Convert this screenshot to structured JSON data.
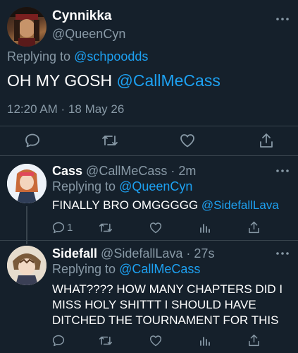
{
  "main_tweet": {
    "display_name": "Cynnikka",
    "handle": "@QueenCyn",
    "replying_prefix": "Replying to",
    "replying_handle": "@schpoodds",
    "text_main": "OH MY GOSH",
    "text_mention": "@CallMeCass",
    "timestamp": "12:20 AM · 18 May 26",
    "actions": [
      "comment-icon",
      "retweet-icon",
      "like-icon",
      "share-icon"
    ]
  },
  "replies": [
    {
      "display_name": "Cass",
      "handle": "@CallMeCass",
      "sep": "·",
      "time": "2m",
      "replying_prefix": "Replying to",
      "replying_handle": "@QueenCyn",
      "text_main": "FINALLY BRO OMGGGGG",
      "text_mention": "@SidefallLava",
      "reply_count": "1",
      "actions": [
        "comment-icon",
        "retweet-icon",
        "like-icon",
        "analytics-icon",
        "share-icon"
      ]
    },
    {
      "display_name": "Sidefall",
      "handle": "@SidefallLava",
      "sep": "·",
      "time": "27s",
      "replying_prefix": "Replying to",
      "replying_handle": "@CallMeCass",
      "text_lines": [
        "WHAT???? HOW MANY CHAPTERS DID I",
        "MISS HOLY SHITTT I SHOULD HAVE",
        "DITCHED THE TOURNAMENT FOR THIS"
      ],
      "actions": [
        "comment-icon",
        "retweet-icon",
        "like-icon",
        "analytics-icon",
        "share-icon"
      ]
    }
  ],
  "colors": {
    "background": "#15202b",
    "text": "#ffffff",
    "muted": "#8899a6",
    "accent": "#1da1f2",
    "divider": "#38444d"
  }
}
